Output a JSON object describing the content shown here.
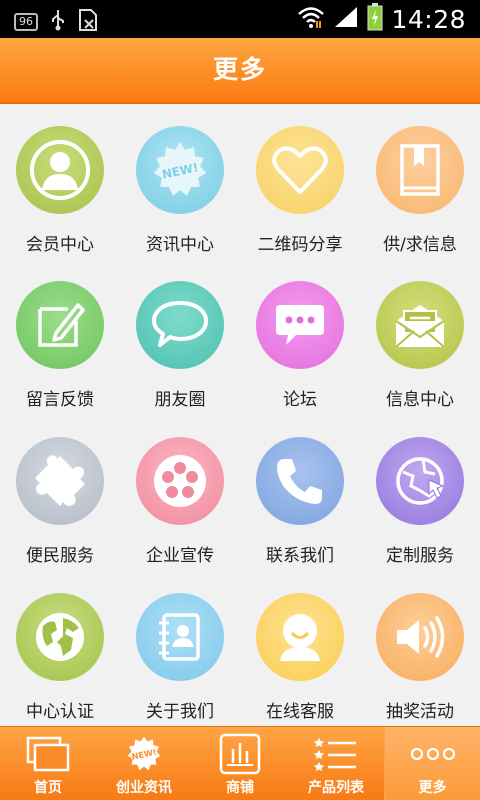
{
  "status_bar": {
    "notification_badge": "96",
    "time": "14:28"
  },
  "header": {
    "title": "更多"
  },
  "grid": {
    "items": [
      {
        "label": "会员中心",
        "icon": "member-icon",
        "color": "#b5cc5e"
      },
      {
        "label": "资讯中心",
        "icon": "new-badge-icon",
        "color": "#8fd7ec"
      },
      {
        "label": "二维码分享",
        "icon": "heart-icon",
        "color": "#fbd97a"
      },
      {
        "label": "供/求信息",
        "icon": "book-icon",
        "color": "#fbbe80"
      },
      {
        "label": "留言反馈",
        "icon": "edit-icon",
        "color": "#7fd06e"
      },
      {
        "label": "朋友圈",
        "icon": "speech-bubble-icon",
        "color": "#5ecdbd"
      },
      {
        "label": "论坛",
        "icon": "chat-dots-icon",
        "color": "#ec7be4"
      },
      {
        "label": "信息中心",
        "icon": "envelope-icon",
        "color": "#c2cf5a"
      },
      {
        "label": "便民服务",
        "icon": "puzzle-icon",
        "color": "#bfc6d0"
      },
      {
        "label": "企业宣传",
        "icon": "film-reel-icon",
        "color": "#f79fae"
      },
      {
        "label": "联系我们",
        "icon": "phone-icon",
        "color": "#8cb0e6"
      },
      {
        "label": "定制服务",
        "icon": "globe-arrow-icon",
        "color": "#aa8ae6"
      },
      {
        "label": "中心认证",
        "icon": "globe-icon",
        "color": "#b1d05d"
      },
      {
        "label": "关于我们",
        "icon": "contacts-book-icon",
        "color": "#8ccff0"
      },
      {
        "label": "在线客服",
        "icon": "customer-service-icon",
        "color": "#fdd66e"
      },
      {
        "label": "抽奖活动",
        "icon": "speaker-icon",
        "color": "#fbbb73"
      }
    ]
  },
  "tabbar": {
    "tabs": [
      {
        "label": "首页",
        "icon": "home-windows-icon"
      },
      {
        "label": "创业资讯",
        "icon": "new-badge-icon"
      },
      {
        "label": "商铺",
        "icon": "shop-chart-icon"
      },
      {
        "label": "产品列表",
        "icon": "star-list-icon"
      },
      {
        "label": "更多",
        "icon": "more-dots-icon"
      }
    ],
    "active_index": 4
  },
  "colors": {
    "header_accent": "#fb8a22",
    "tabbar_accent": "#f98c28"
  }
}
